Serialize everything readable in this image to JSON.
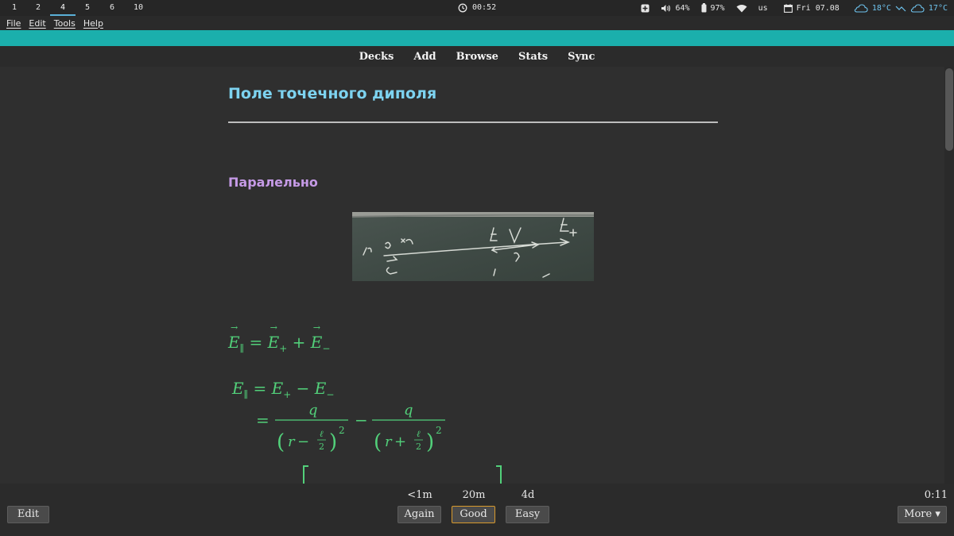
{
  "system_bar": {
    "workspaces": [
      {
        "label": "1",
        "active": false
      },
      {
        "label": "2",
        "active": false
      },
      {
        "label": "4",
        "active": true
      },
      {
        "label": "5",
        "active": false
      },
      {
        "label": "6",
        "active": false
      },
      {
        "label": "10",
        "active": false
      }
    ],
    "clock": "00:52",
    "volume": "64%",
    "battery": "97%",
    "keyboard_layout": "us",
    "date": "Fri 07.08",
    "weather_current": "18°C",
    "weather_forecast": "17°C",
    "colors": {
      "active_workspace": "#5ab0d8",
      "weather": "#6ec3ee"
    }
  },
  "menu": {
    "items": [
      {
        "label": "File"
      },
      {
        "label": "Edit"
      },
      {
        "label": "Tools"
      },
      {
        "label": "Help"
      }
    ]
  },
  "toolbar": {
    "items": [
      {
        "label": "Decks"
      },
      {
        "label": "Add"
      },
      {
        "label": "Browse"
      },
      {
        "label": "Stats"
      },
      {
        "label": "Sync"
      }
    ]
  },
  "card": {
    "title": "Поле точечного диполя",
    "subtitle": "Паралельно",
    "formulas": {
      "line1_lhs": "E",
      "line1_sub": "∥",
      "line1_rhs": "= E₊ + E₋",
      "line2": "E∥ = E₊ − E₋",
      "frac_num": "q",
      "frac1_den": "(r − ℓ/2)²",
      "frac2_den": "(r + ℓ/2)²"
    },
    "colors": {
      "title": "#7dd3f0",
      "subtitle": "#c59ae6",
      "math": "#52d07a"
    }
  },
  "review": {
    "buttons": [
      {
        "label": "Again",
        "interval": "<1m"
      },
      {
        "label": "Good",
        "interval": "20m",
        "selected": true
      },
      {
        "label": "Easy",
        "interval": "4d"
      }
    ],
    "edit_label": "Edit",
    "more_label": "More ▾",
    "timer": "0:11",
    "colors": {
      "selected_border": "#d89a2c"
    }
  }
}
